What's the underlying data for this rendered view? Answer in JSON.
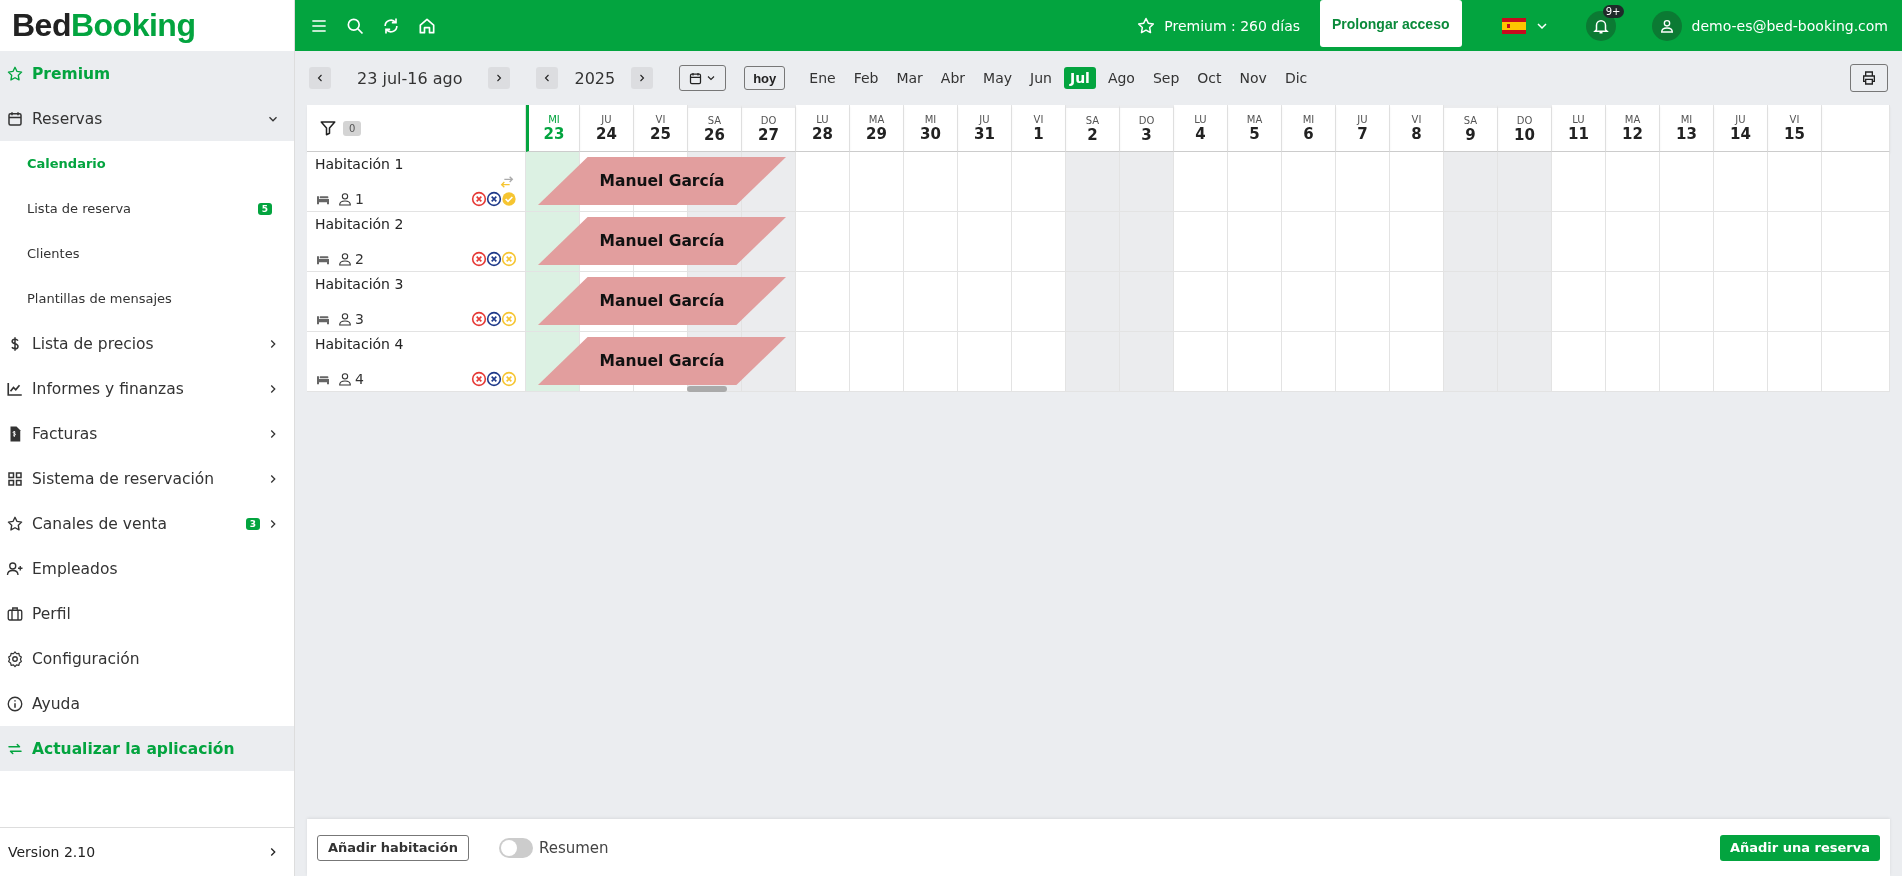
{
  "logo": {
    "dark": "Bed",
    "green": "Booking"
  },
  "topbar": {
    "premium": "Premium : 260 días",
    "extend_button": "Prolongar acceso",
    "notifications": "9+",
    "user": "demo-es@bed-booking.com"
  },
  "sidebar": {
    "items": [
      {
        "kind": "promo",
        "label": "Premium"
      },
      {
        "kind": "section",
        "label": "Reservas",
        "expanded": true,
        "children": [
          {
            "label": "Calendario",
            "selected": true
          },
          {
            "label": "Lista de reserva",
            "selected": false,
            "badge": "5"
          },
          {
            "label": "Clientes",
            "selected": false
          },
          {
            "label": "Plantillas de mensajes",
            "selected": false
          }
        ]
      },
      {
        "kind": "section",
        "label": "Lista de precios",
        "expanded": false
      },
      {
        "kind": "section",
        "label": "Informes y finanzas",
        "expanded": false
      },
      {
        "kind": "section",
        "label": "Facturas",
        "expanded": false
      },
      {
        "kind": "section",
        "label": "Sistema de reservación",
        "expanded": false
      },
      {
        "kind": "section",
        "label": "Canales de venta",
        "expanded": false,
        "badge": "3"
      },
      {
        "kind": "link",
        "label": "Empleados"
      },
      {
        "kind": "link",
        "label": "Perfil"
      },
      {
        "kind": "link",
        "label": "Configuración"
      },
      {
        "kind": "link",
        "label": "Ayuda"
      },
      {
        "kind": "promo",
        "label": "Actualizar la aplicación"
      }
    ],
    "version": "Version 2.10"
  },
  "toolbar": {
    "range": "23 jul-16 ago",
    "year": "2025",
    "today_button": "hoy",
    "months": [
      {
        "label": "Ene",
        "selected": false
      },
      {
        "label": "Feb",
        "selected": false
      },
      {
        "label": "Mar",
        "selected": false
      },
      {
        "label": "Abr",
        "selected": false
      },
      {
        "label": "May",
        "selected": false
      },
      {
        "label": "Jun",
        "selected": false
      },
      {
        "label": "Jul",
        "selected": true
      },
      {
        "label": "Ago",
        "selected": false
      },
      {
        "label": "Sep",
        "selected": false
      },
      {
        "label": "Oct",
        "selected": false
      },
      {
        "label": "Nov",
        "selected": false
      },
      {
        "label": "Dic",
        "selected": false
      }
    ]
  },
  "calendar": {
    "filter_count": "0",
    "days": [
      {
        "weekday": "MI",
        "day": "23",
        "weekend": false,
        "today": true
      },
      {
        "weekday": "JU",
        "day": "24",
        "weekend": false,
        "today": false
      },
      {
        "weekday": "VI",
        "day": "25",
        "weekend": false,
        "today": false
      },
      {
        "weekday": "SA",
        "day": "26",
        "weekend": true,
        "today": false
      },
      {
        "weekday": "DO",
        "day": "27",
        "weekend": true,
        "today": false
      },
      {
        "weekday": "LU",
        "day": "28",
        "weekend": false,
        "today": false
      },
      {
        "weekday": "MA",
        "day": "29",
        "weekend": false,
        "today": false
      },
      {
        "weekday": "MI",
        "day": "30",
        "weekend": false,
        "today": false
      },
      {
        "weekday": "JU",
        "day": "31",
        "weekend": false,
        "today": false
      },
      {
        "weekday": "VI",
        "day": "1",
        "weekend": false,
        "today": false
      },
      {
        "weekday": "SA",
        "day": "2",
        "weekend": true,
        "today": false
      },
      {
        "weekday": "DO",
        "day": "3",
        "weekend": true,
        "today": false
      },
      {
        "weekday": "LU",
        "day": "4",
        "weekend": false,
        "today": false
      },
      {
        "weekday": "MA",
        "day": "5",
        "weekend": false,
        "today": false
      },
      {
        "weekday": "MI",
        "day": "6",
        "weekend": false,
        "today": false
      },
      {
        "weekday": "JU",
        "day": "7",
        "weekend": false,
        "today": false
      },
      {
        "weekday": "VI",
        "day": "8",
        "weekend": false,
        "today": false
      },
      {
        "weekday": "SA",
        "day": "9",
        "weekend": true,
        "today": false
      },
      {
        "weekday": "DO",
        "day": "10",
        "weekend": true,
        "today": false
      },
      {
        "weekday": "LU",
        "day": "11",
        "weekend": false,
        "today": false
      },
      {
        "weekday": "MA",
        "day": "12",
        "weekend": false,
        "today": false
      },
      {
        "weekday": "MI",
        "day": "13",
        "weekend": false,
        "today": false
      },
      {
        "weekday": "JU",
        "day": "14",
        "weekend": false,
        "today": false
      },
      {
        "weekday": "VI",
        "day": "15",
        "weekend": false,
        "today": false
      }
    ],
    "rooms": [
      {
        "name": "Habitación 1",
        "guests": "1",
        "transfer": true,
        "marks": [
          {
            "kind": "cross",
            "color": "#e53935"
          },
          {
            "kind": "cross",
            "color": "#1f3a8a"
          },
          {
            "kind": "check",
            "color": "#f6c531"
          }
        ],
        "booking": "Manuel García"
      },
      {
        "name": "Habitación 2",
        "guests": "2",
        "transfer": false,
        "marks": [
          {
            "kind": "cross",
            "color": "#e53935"
          },
          {
            "kind": "cross",
            "color": "#1f3a8a"
          },
          {
            "kind": "cross",
            "color": "#f6c531"
          }
        ],
        "booking": "Manuel García"
      },
      {
        "name": "Habitación 3",
        "guests": "3",
        "transfer": false,
        "marks": [
          {
            "kind": "cross",
            "color": "#e53935"
          },
          {
            "kind": "cross",
            "color": "#1f3a8a"
          },
          {
            "kind": "cross",
            "color": "#f6c531"
          }
        ],
        "booking": "Manuel García"
      },
      {
        "name": "Habitación 4",
        "guests": "4",
        "transfer": false,
        "marks": [
          {
            "kind": "cross",
            "color": "#e53935"
          },
          {
            "kind": "cross",
            "color": "#1f3a8a"
          },
          {
            "kind": "cross",
            "color": "#f6c531"
          }
        ],
        "booking": "Manuel García"
      }
    ]
  },
  "footer": {
    "add_room": "Añadir habitación",
    "summary": {
      "label": "Resumen",
      "on": false
    },
    "add_booking": "Añadir una reserva"
  }
}
